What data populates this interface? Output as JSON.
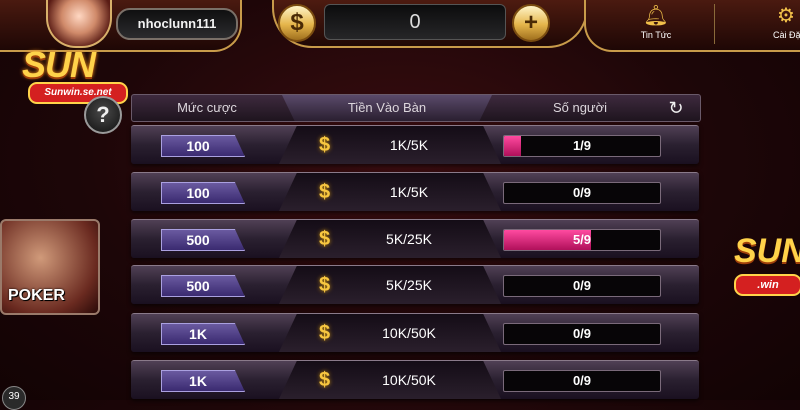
{
  "header": {
    "username": "nhoclunn111",
    "balance": "0",
    "currency_symbol": "$",
    "add_symbol": "+",
    "news_label": "Tin Tức",
    "settings_label": "Cài Đặt"
  },
  "logo": {
    "text": "SUN",
    "subtext": "Sunwin.se.net"
  },
  "help_symbol": "?",
  "table": {
    "columns": [
      "Mức cược",
      "Tiền Vào Bàn",
      "Số người"
    ],
    "rows": [
      {
        "bet": "100",
        "entry": "1K/5K",
        "players": "1/9",
        "fill": 0.11
      },
      {
        "bet": "100",
        "entry": "1K/5K",
        "players": "0/9",
        "fill": 0
      },
      {
        "bet": "500",
        "entry": "5K/25K",
        "players": "5/9",
        "fill": 0.56
      },
      {
        "bet": "500",
        "entry": "5K/25K",
        "players": "0/9",
        "fill": 0
      },
      {
        "bet": "1K",
        "entry": "10K/50K",
        "players": "0/9",
        "fill": 0
      },
      {
        "bet": "1K",
        "entry": "10K/50K",
        "players": "0/9",
        "fill": 0
      }
    ]
  },
  "side": {
    "poker_label": "POKER",
    "right_logo_text": "SUN",
    "right_logo_sub": ".win",
    "level": "39"
  },
  "colors": {
    "accent_gold": "#f7c640",
    "fill_pink": "#ff4aa0"
  }
}
